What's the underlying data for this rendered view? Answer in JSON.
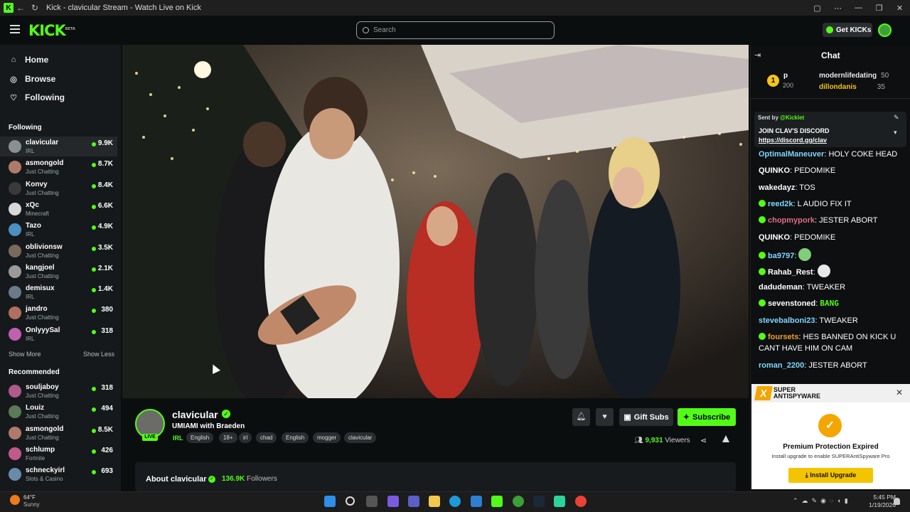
{
  "window": {
    "title": "Kick - clavicular Stream - Watch Live on Kick",
    "controls": [
      "▢",
      "⋯",
      "—",
      "❐",
      "✕"
    ]
  },
  "topnav": {
    "logo": "KICK",
    "logo_beta": "BETA",
    "search_placeholder": "Search",
    "get_kicks": "Get KICKs"
  },
  "sidebar": {
    "main": [
      {
        "label": "Home",
        "icon": "home-icon"
      },
      {
        "label": "Browse",
        "icon": "compass-icon"
      },
      {
        "label": "Following",
        "icon": "heart-icon"
      }
    ],
    "following_title": "Following",
    "following": [
      {
        "name": "clavicular",
        "category": "IRL",
        "viewers": "9.9K",
        "color": "#8a8f92"
      },
      {
        "name": "asmongold",
        "category": "Just Chatting",
        "viewers": "8.7K",
        "color": "#b07a6a"
      },
      {
        "name": "Konvy",
        "category": "Just Chatting",
        "viewers": "8.4K",
        "color": "#3a3a3a"
      },
      {
        "name": "xQc",
        "category": "Minecraft",
        "viewers": "6.6K",
        "color": "#d8d8d8"
      },
      {
        "name": "Tazo",
        "category": "IRL",
        "viewers": "4.9K",
        "color": "#4d8fc2"
      },
      {
        "name": "oblivionsw",
        "category": "Just Chatting",
        "viewers": "3.5K",
        "color": "#7a6a5a"
      },
      {
        "name": "kangjoel",
        "category": "Just Chatting",
        "viewers": "2.1K",
        "color": "#9a9a9a"
      },
      {
        "name": "demisux",
        "category": "IRL",
        "viewers": "1.4K",
        "color": "#6a7a8a"
      },
      {
        "name": "jandro",
        "category": "Just Chatting",
        "viewers": "380",
        "color": "#b07060"
      },
      {
        "name": "OnlyyySal",
        "category": "IRL",
        "viewers": "318",
        "color": "#c060b0"
      }
    ],
    "show_more": "Show More",
    "show_less": "Show Less",
    "recommended_title": "Recommended",
    "recommended": [
      {
        "name": "souljaboy",
        "category": "Just Chatting",
        "viewers": "318",
        "color": "#b05a8a"
      },
      {
        "name": "Louiz",
        "category": "Just Chatting",
        "viewers": "494",
        "color": "#5a7a5a"
      },
      {
        "name": "asmongold",
        "category": "Just Chatting",
        "viewers": "8.5K",
        "color": "#b07a6a"
      },
      {
        "name": "schlump",
        "category": "Fortnite",
        "viewers": "426",
        "color": "#c05a8a"
      },
      {
        "name": "schneckyirl",
        "category": "Slots & Casino",
        "viewers": "693",
        "color": "#6a8aaa"
      }
    ]
  },
  "channel": {
    "name": "clavicular",
    "live": "LIVE",
    "stream_title": "UMIAMI with Braeden",
    "category": "IRL",
    "tags": [
      "English",
      "18+",
      "irl",
      "chad",
      "English",
      "mogger",
      "clavicular"
    ],
    "gift_subs": "Gift Subs",
    "subscribe": "Subscribe",
    "viewers_count": "9,931",
    "viewers_label": "Viewers",
    "about_title": "About clavicular",
    "followers_count": "136.9K",
    "followers_label": "Followers"
  },
  "chat": {
    "title": "Chat",
    "leaderboard": {
      "rank": "1",
      "first_letter": "p",
      "first_count": "200",
      "users": [
        {
          "name": "modernlifedating",
          "count": "50",
          "color": "#ffffff"
        },
        {
          "name": "dillondanis",
          "count": "35",
          "color": "#f5c518"
        }
      ]
    },
    "pinned": {
      "sent_by": "Sent by",
      "sender": "@Kicklet",
      "message": "JOIN CLAV'S DISCORD",
      "link": "https://discord.gg/clav"
    },
    "messages": [
      {
        "user": "OptimalManeuver",
        "color": "#7fd6ff",
        "badge": false,
        "text": "HOLY COKE HEAD"
      },
      {
        "user": "QUINKO",
        "color": "#ffffff",
        "badge": false,
        "text": "PEDOMIKE"
      },
      {
        "user": "wakedayz",
        "color": "#ffffff",
        "badge": false,
        "text": "TOS"
      },
      {
        "user": "reed2k",
        "color": "#7fd6ff",
        "badge": true,
        "text": "L AUDIO FIX IT"
      },
      {
        "user": "chopmypork",
        "color": "#e46a8a",
        "badge": true,
        "text": "JESTER ABORT"
      },
      {
        "user": "QUINKO",
        "color": "#ffffff",
        "badge": false,
        "text": "PEDOMIKE"
      },
      {
        "user": "ba9797",
        "color": "#7fd6ff",
        "badge": true,
        "text": ""
      },
      {
        "user": "Rahab_Rest",
        "color": "#ffffff",
        "badge": true,
        "text": ""
      },
      {
        "user": "dadudeman",
        "color": "#ffffff",
        "badge": false,
        "text": "TWEAKER"
      },
      {
        "user": "sevenstoned",
        "color": "#ffffff",
        "badge": true,
        "text": ""
      },
      {
        "user": "stevebalboni23",
        "color": "#7fd6ff",
        "badge": false,
        "text": "TWEAKER"
      },
      {
        "user": "foursets",
        "color": "#f0a030",
        "badge": true,
        "text": "HES BANNED ON KICK U CANT HAVE HIM ON CAM"
      },
      {
        "user": "roman_2200",
        "color": "#7fd6ff",
        "badge": false,
        "text": "JESTER ABORT"
      }
    ],
    "emote_bang": "BANG"
  },
  "ad": {
    "brand_line1": "SUPER",
    "brand_line2": "ANTISPYWARE",
    "title": "Premium Protection Expired",
    "subtitle": "Install upgrade to enable SUPERAntiSpyware Pro",
    "button": "Install Upgrade"
  },
  "taskbar": {
    "temp": "64°F",
    "condition": "Sunny",
    "time": "5:45 PM",
    "date": "1/19/2026"
  },
  "colors": {
    "accent": "#53fc18",
    "background": "#0b0e0f",
    "sidebar": "#16191c"
  }
}
